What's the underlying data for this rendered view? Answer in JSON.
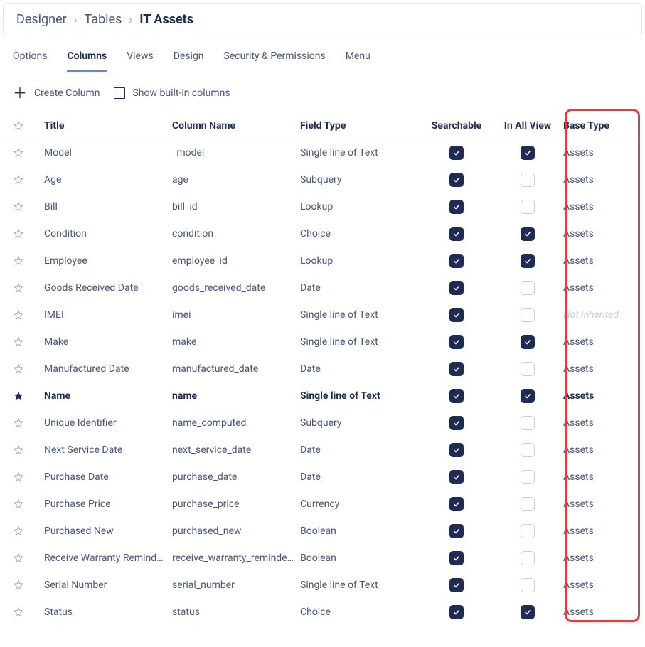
{
  "breadcrumb": {
    "items": [
      "Designer",
      "Tables",
      "IT Assets"
    ],
    "current_index": 2
  },
  "tabs": {
    "items": [
      "Options",
      "Columns",
      "Views",
      "Design",
      "Security & Permissions",
      "Menu"
    ],
    "active_index": 1
  },
  "toolbar": {
    "create_label": "Create Column",
    "show_builtin_label": "Show built-in columns",
    "show_builtin_checked": false
  },
  "table": {
    "headers": {
      "title": "Title",
      "column_name": "Column Name",
      "field_type": "Field Type",
      "searchable": "Searchable",
      "in_all_view": "In All View",
      "base_type": "Base Type"
    },
    "not_inherited_label": "Not inherited",
    "rows": [
      {
        "title": "Model",
        "name": "_model",
        "type": "Single line of Text",
        "searchable": true,
        "in_all_view": true,
        "base": "Assets",
        "primary": false,
        "inherited": true
      },
      {
        "title": "Age",
        "name": "age",
        "type": "Subquery",
        "searchable": true,
        "in_all_view": false,
        "base": "Assets",
        "primary": false,
        "inherited": true
      },
      {
        "title": "Bill",
        "name": "bill_id",
        "type": "Lookup",
        "searchable": true,
        "in_all_view": false,
        "base": "Assets",
        "primary": false,
        "inherited": true
      },
      {
        "title": "Condition",
        "name": "condition",
        "type": "Choice",
        "searchable": true,
        "in_all_view": true,
        "base": "Assets",
        "primary": false,
        "inherited": true
      },
      {
        "title": "Employee",
        "name": "employee_id",
        "type": "Lookup",
        "searchable": true,
        "in_all_view": true,
        "base": "Assets",
        "primary": false,
        "inherited": true
      },
      {
        "title": "Goods Received Date",
        "name": "goods_received_date",
        "type": "Date",
        "searchable": true,
        "in_all_view": false,
        "base": "Assets",
        "primary": false,
        "inherited": true
      },
      {
        "title": "IMEI",
        "name": "imei",
        "type": "Single line of Text",
        "searchable": true,
        "in_all_view": false,
        "base": "",
        "primary": false,
        "inherited": false
      },
      {
        "title": "Make",
        "name": "make",
        "type": "Single line of Text",
        "searchable": true,
        "in_all_view": true,
        "base": "Assets",
        "primary": false,
        "inherited": true
      },
      {
        "title": "Manufactured Date",
        "name": "manufactured_date",
        "type": "Date",
        "searchable": true,
        "in_all_view": false,
        "base": "Assets",
        "primary": false,
        "inherited": true
      },
      {
        "title": "Name",
        "name": "name",
        "type": "Single line of Text",
        "searchable": true,
        "in_all_view": true,
        "base": "Assets",
        "primary": true,
        "inherited": true
      },
      {
        "title": "Unique Identifier",
        "name": "name_computed",
        "type": "Subquery",
        "searchable": true,
        "in_all_view": false,
        "base": "Assets",
        "primary": false,
        "inherited": true
      },
      {
        "title": "Next Service Date",
        "name": "next_service_date",
        "type": "Date",
        "searchable": true,
        "in_all_view": false,
        "base": "Assets",
        "primary": false,
        "inherited": true
      },
      {
        "title": "Purchase Date",
        "name": "purchase_date",
        "type": "Date",
        "searchable": true,
        "in_all_view": false,
        "base": "Assets",
        "primary": false,
        "inherited": true
      },
      {
        "title": "Purchase Price",
        "name": "purchase_price",
        "type": "Currency",
        "searchable": true,
        "in_all_view": false,
        "base": "Assets",
        "primary": false,
        "inherited": true
      },
      {
        "title": "Purchased New",
        "name": "purchased_new",
        "type": "Boolean",
        "searchable": true,
        "in_all_view": false,
        "base": "Assets",
        "primary": false,
        "inherited": true
      },
      {
        "title": "Receive Warranty Reminders",
        "name": "receive_warranty_reminders",
        "type": "Boolean",
        "searchable": true,
        "in_all_view": false,
        "base": "Assets",
        "primary": false,
        "inherited": true
      },
      {
        "title": "Serial Number",
        "name": "serial_number",
        "type": "Single line of Text",
        "searchable": true,
        "in_all_view": false,
        "base": "Assets",
        "primary": false,
        "inherited": true
      },
      {
        "title": "Status",
        "name": "status",
        "type": "Choice",
        "searchable": true,
        "in_all_view": true,
        "base": "Assets",
        "primary": false,
        "inherited": true
      }
    ]
  },
  "highlight": {
    "column": "base_type"
  }
}
